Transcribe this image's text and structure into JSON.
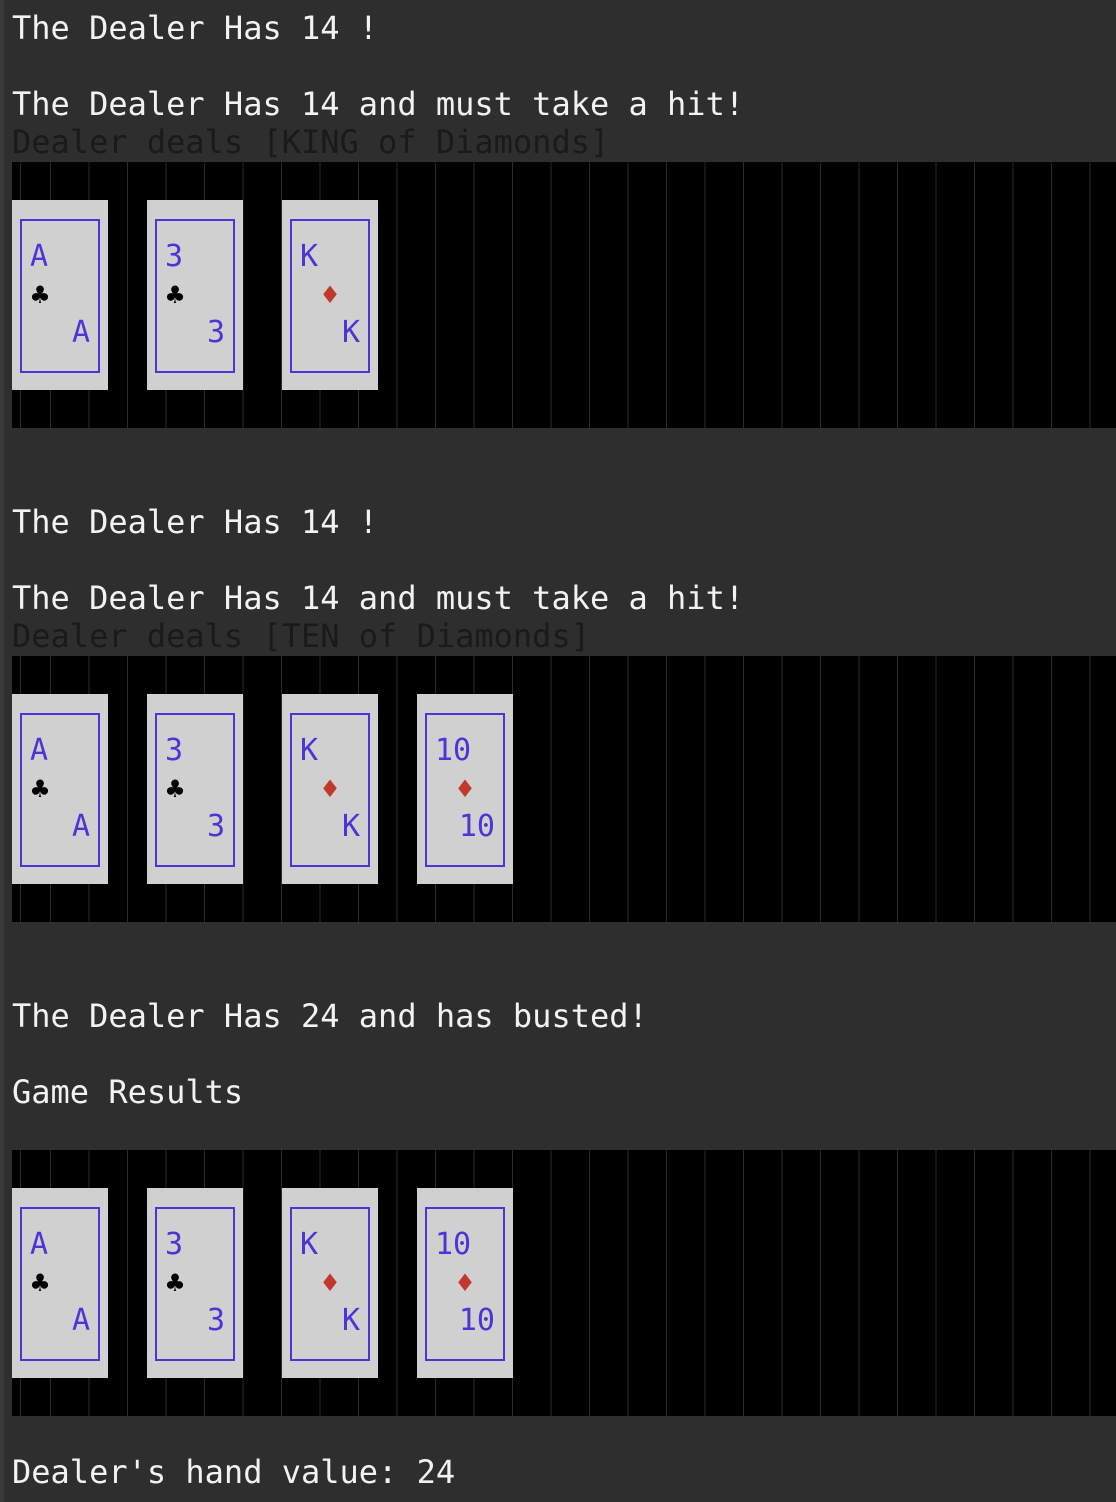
{
  "lines": {
    "l1": "The Dealer Has 14 !",
    "l2": "The Dealer Has 14 and must take a hit!",
    "l3": "Dealer deals [KING of Diamonds]",
    "l4": "The Dealer Has 14 !",
    "l5": "The Dealer Has 14 and must take a hit!",
    "l6": "Dealer deals [TEN of Diamonds]",
    "l7": "The Dealer Has 24 and has busted!",
    "l8": "Game Results",
    "l9": "Dealer's hand value: 24"
  },
  "hands": [
    {
      "cards": [
        {
          "rank": "A",
          "suit": "♣",
          "suit_name": "clubs"
        },
        {
          "rank": "3",
          "suit": "♣",
          "suit_name": "clubs"
        },
        {
          "rank": "K",
          "suit": "♦",
          "suit_name": "diamonds"
        }
      ]
    },
    {
      "cards": [
        {
          "rank": "A",
          "suit": "♣",
          "suit_name": "clubs"
        },
        {
          "rank": "3",
          "suit": "♣",
          "suit_name": "clubs"
        },
        {
          "rank": "K",
          "suit": "♦",
          "suit_name": "diamonds"
        },
        {
          "rank": "10",
          "suit": "♦",
          "suit_name": "diamonds"
        }
      ]
    },
    {
      "cards": [
        {
          "rank": "A",
          "suit": "♣",
          "suit_name": "clubs"
        },
        {
          "rank": "3",
          "suit": "♣",
          "suit_name": "clubs"
        },
        {
          "rank": "K",
          "suit": "♦",
          "suit_name": "diamonds"
        },
        {
          "rank": "10",
          "suit": "♦",
          "suit_name": "diamonds"
        }
      ]
    }
  ],
  "colors": {
    "background": "#2e2e2e",
    "band": "#000000",
    "card": "#d0d0d0",
    "card_border": "#4b35d6",
    "red_suit": "#c0392b"
  }
}
